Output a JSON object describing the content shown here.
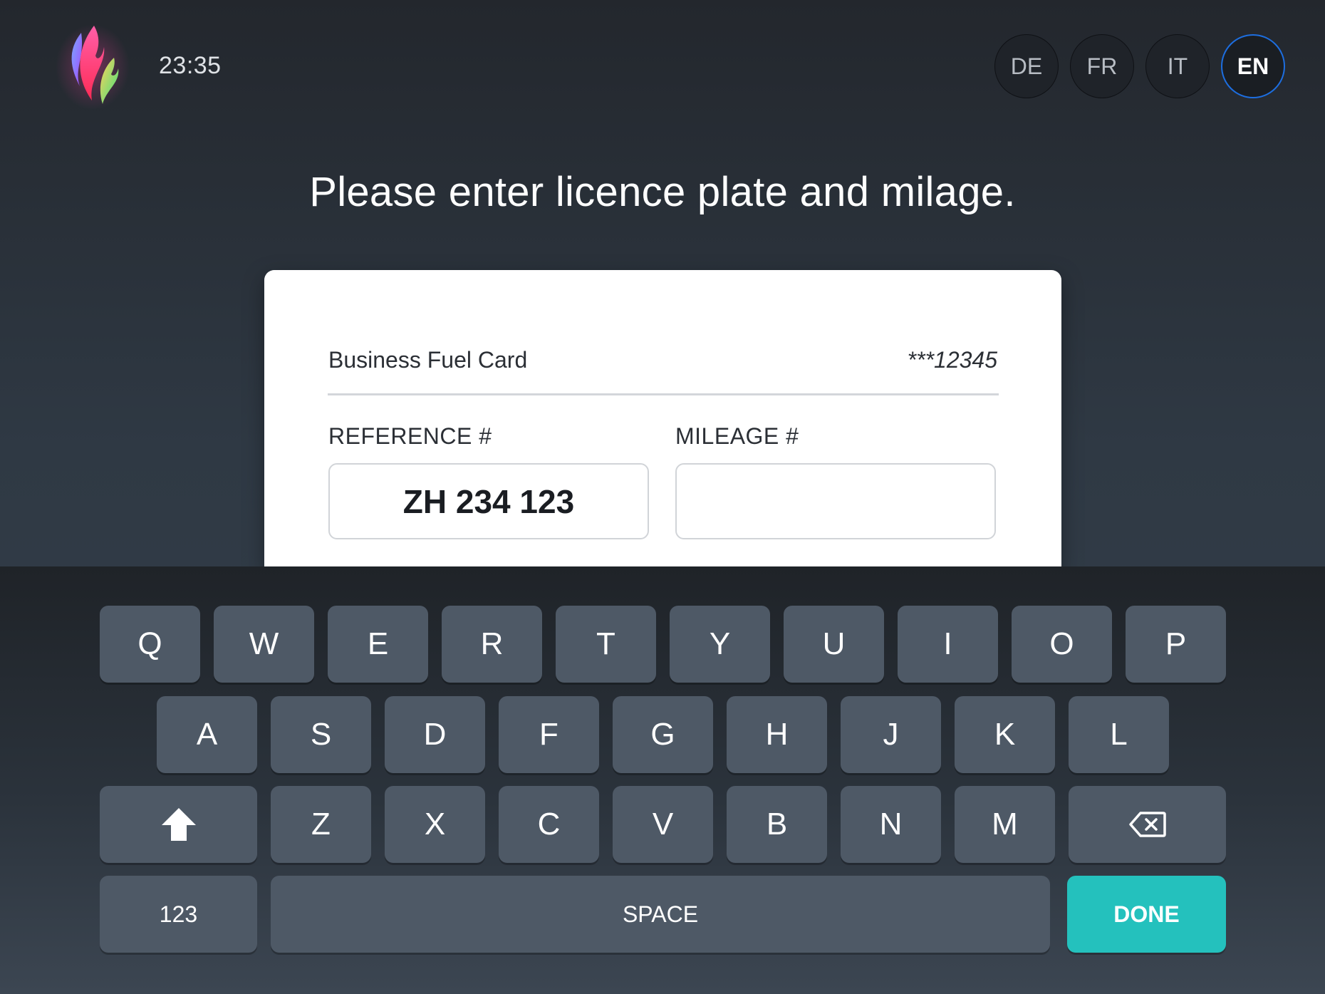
{
  "header": {
    "time": "23:35",
    "languages": [
      {
        "code": "DE",
        "active": false
      },
      {
        "code": "FR",
        "active": false
      },
      {
        "code": "IT",
        "active": false
      },
      {
        "code": "EN",
        "active": true
      }
    ]
  },
  "prompt": "Please enter licence plate and milage.",
  "card": {
    "name": "Business Fuel Card",
    "number": "***12345"
  },
  "fields": {
    "reference": {
      "label": "REFERENCE #",
      "value": "ZH 234 123"
    },
    "mileage": {
      "label": "MILEAGE #",
      "value": ""
    }
  },
  "keyboard": {
    "row1": [
      "Q",
      "W",
      "E",
      "R",
      "T",
      "Y",
      "U",
      "I",
      "O",
      "P"
    ],
    "row2": [
      "A",
      "S",
      "D",
      "F",
      "G",
      "H",
      "J",
      "K",
      "L"
    ],
    "row3": [
      "Z",
      "X",
      "C",
      "V",
      "B",
      "N",
      "M"
    ],
    "numbers_label": "123",
    "space_label": "SPACE",
    "done_label": "DONE",
    "accent_color": "#24c1bd"
  }
}
